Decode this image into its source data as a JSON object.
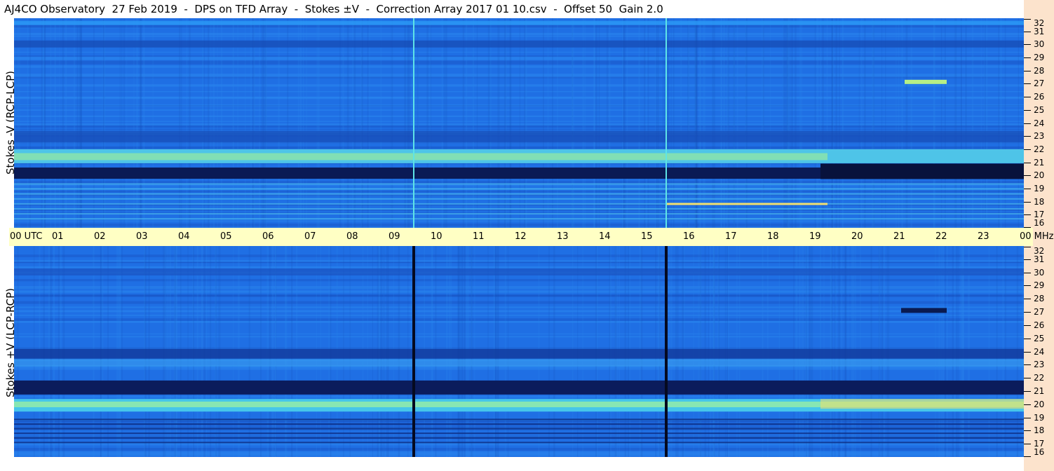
{
  "title": "AJ4CO Observatory  27 Feb 2019  -  DPS on TFD Array  -  Stokes ±V  -  Correction Array 2017 01 10.csv  -  Offset 50  Gain 2.0",
  "colors": {
    "background_blue": "#1e6ee6",
    "dark_band": "#0a1a55",
    "bright_band": "#7de8b0",
    "timebar": "#ffffc4",
    "corner": "#fce3cc"
  },
  "chart_data": [
    {
      "type": "heatmap",
      "title": "AJ4CO Observatory  27 Feb 2019  -  DPS on TFD Array  -  Stokes ±V  -  Correction Array 2017 01 10.csv  -  Offset 50  Gain 2.0",
      "ylabel": "Stokes -V (RCP-LCP)",
      "x_ticks": [
        "00 UTC",
        "01",
        "02",
        "03",
        "04",
        "05",
        "06",
        "07",
        "08",
        "09",
        "10",
        "11",
        "12",
        "13",
        "14",
        "15",
        "16",
        "17",
        "18",
        "19",
        "20",
        "21",
        "22",
        "23",
        "00 MHz"
      ],
      "y_ticks": [
        "32",
        "31",
        "30",
        "29",
        "28",
        "27",
        "26",
        "25",
        "24",
        "23",
        "22",
        "21",
        "20",
        "19",
        "18",
        "17",
        "16"
      ],
      "ylim": [
        16,
        32
      ],
      "xlim_utc_hours": [
        0,
        24
      ],
      "features": {
        "dark_band_mhz": 20,
        "bright_band_mhz": 21.4,
        "vertical_lines_utc": [
          9.5,
          15.5
        ],
        "vertical_line_color": "bright"
      }
    },
    {
      "type": "heatmap",
      "ylabel": "Stokes +V (LCP-RCP)",
      "x_ticks": [
        "00 UTC",
        "01",
        "02",
        "03",
        "04",
        "05",
        "06",
        "07",
        "08",
        "09",
        "10",
        "11",
        "12",
        "13",
        "14",
        "15",
        "16",
        "17",
        "18",
        "19",
        "20",
        "21",
        "22",
        "23",
        "00 MHz"
      ],
      "y_ticks": [
        "32",
        "31",
        "30",
        "29",
        "28",
        "27",
        "26",
        "25",
        "24",
        "23",
        "22",
        "21",
        "20",
        "19",
        "18",
        "17",
        "16"
      ],
      "ylim": [
        16,
        32
      ],
      "xlim_utc_hours": [
        0,
        24
      ],
      "features": {
        "dark_band_mhz": 21.3,
        "bright_band_mhz": 19.9,
        "vertical_lines_utc": [
          9.5,
          15.5
        ],
        "vertical_line_color": "dark"
      }
    }
  ]
}
